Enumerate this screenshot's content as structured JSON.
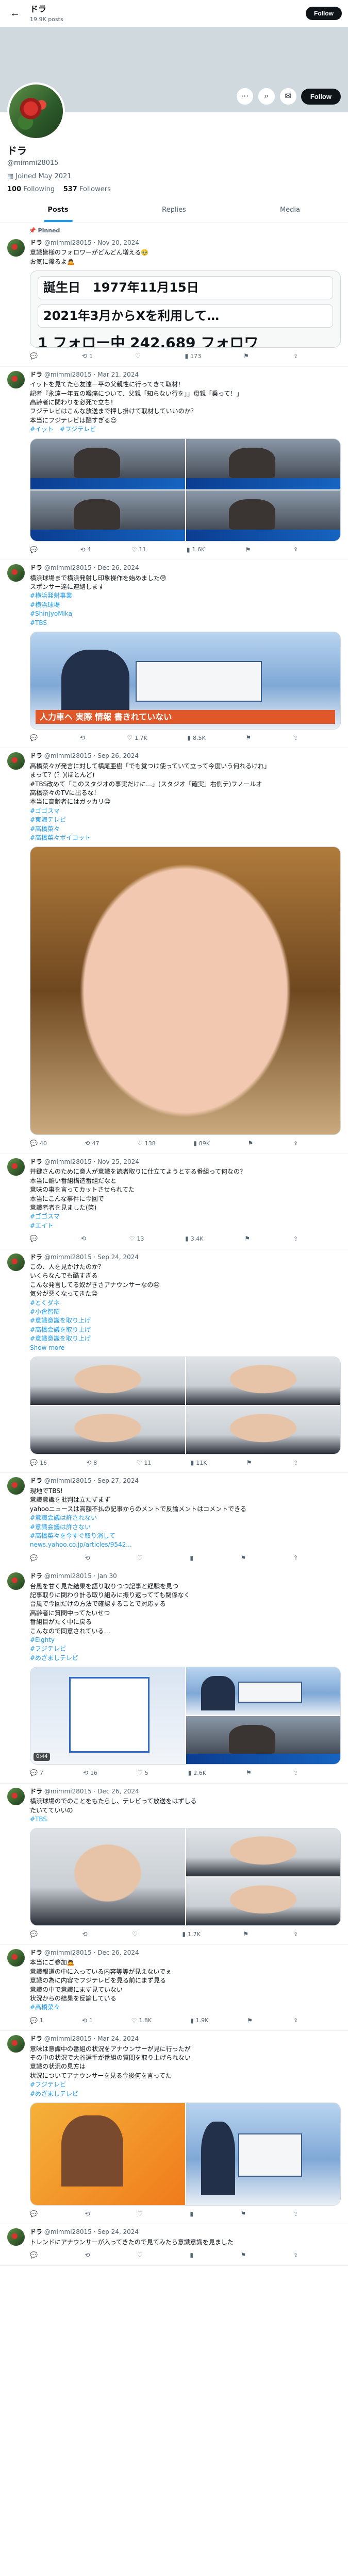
{
  "topbar": {
    "name": "ドラ",
    "post_count": "19.9K posts",
    "follow_label": "Follow"
  },
  "profile": {
    "name": "ドラ",
    "handle": "@mimmi28015",
    "joined": "Joined May 2021",
    "following_num": "100",
    "following_label": "Following",
    "followers_num": "537",
    "followers_label": "Followers",
    "follow_label": "Follow"
  },
  "tabs": [
    {
      "label": "Posts"
    },
    {
      "label": "Replies"
    },
    {
      "label": "Media"
    }
  ],
  "pinned_label": "Pinned",
  "tweets": [
    {
      "name": "ドラ",
      "meta": "@mimmi28015 · Nov 20, 2024",
      "text": "意識皆様のフォロワーがどんどん増える🥹\nお気に障るよ🙇",
      "card": {
        "line1": "誕生日　1977年11月15日",
        "line2": "2021年3月からXを利用して…",
        "line3_a": "1",
        "line3_b": "フォロー中",
        "line3_c": "242,689",
        "line3_d": "フォロワ"
      },
      "reply": "",
      "repost": "1",
      "like": "",
      "views": "173",
      "bookmark": ""
    },
    {
      "name": "ドラ",
      "meta": "@mimmi28015 · Mar 21, 2024",
      "text": "イットを見てたら友達ー平の父親性に行ってきて取材！\n記者『永遠ー年五の喉痛について、父親「知らない行を」」母親「乗って！」\n高齢者に関わりを必死で立ち！\nフジテレビはこんな放送まで押し掛けて取材していいのか？\n本当にフジテレビは酷すぎる😔",
      "tags": "#イット　#フジテレビ",
      "reply": "",
      "repost": "4",
      "like": "11",
      "views": "1.6K",
      "bookmark": ""
    },
    {
      "name": "ドラ",
      "meta": "@mimmi28015 · Dec 26, 2024",
      "text": "横浜球場まで横浜発射し印象操作を始めました😓\nスポンサー達に連絡します",
      "tags": "#横浜発射事業\n#横浜球場\n#ShinJyoMika\n#TBS",
      "overlay": "人力車ヘ 実際 情報 書きれていない",
      "reply": "",
      "repost": "",
      "like": "1.7K",
      "views": "8.5K",
      "bookmark": ""
    },
    {
      "name": "ドラ",
      "meta": "@mimmi28015 · Sep 26, 2024",
      "text": "高橋菜々が発言に対して横尾亜樹「でも覚つけ使っていて立って今度いう何れるけれ」\nまって？(？)(ほとんど)\n#TBS改めて「このスタジオの事実だけに…」(スタジオ「確実」右側テ)フノールオ\n高橋奈々のTVに出るな！\n本当に高齢者にはガッカリ😔",
      "tags": "#ゴゴスマ\n#東海テレビ\n#高橋菜々\n#高橋菜々ボイコット",
      "reply": "40",
      "repost": "47",
      "like": "138",
      "views": "89K",
      "bookmark": ""
    },
    {
      "name": "ドラ",
      "meta": "@mimmi28015 · Nov 25, 2024",
      "text": "井鍵さんのために意人が意識を読者取りに仕立てようとする番組って何なの？\n本当に酷い番組構造番組だなと\n意味の事を言ってカットさせられてた\n本当にこんな事件に今回で\n意識者者を見ました(笑)",
      "tags": "#ゴゴスマ\n#エイト",
      "reply": "",
      "repost": "",
      "like": "13",
      "views": "3.4K",
      "bookmark": ""
    },
    {
      "name": "ドラ",
      "meta": "@mimmi28015 · Sep 24, 2024",
      "text": "この、人を見かけたのか？\nいくらなんでも酷すぎる\nこんな発言してる奴がきさアナウンサーなの😔\n気分が悪くなってきた😔",
      "tags": "#とくダネ\n#小倉智昭\n#意識意識を取り上げ\n#高橋会議を取り上げ\n#意識意識を取り上げ",
      "show_more": "Show more",
      "reply": "16",
      "repost": "8",
      "like": "11",
      "views": "11K",
      "bookmark": ""
    },
    {
      "name": "ドラ",
      "meta": "@mimmi28015 · Sep 27, 2024",
      "text": "現地でTBS!\n意識意識を批判は立たずまず\nyahooニュースは高額不払の記事からのメントで反論メントはコメントできる",
      "tags": "#意識会議は許されない\n#意識会議は許さない\n#高橋菜々を今すぐ取り消して",
      "link": "news.yahoo.co.jp/articles/9542...",
      "reply": "",
      "repost": "",
      "like": "",
      "views": "",
      "bookmark": ""
    },
    {
      "name": "ドラ",
      "meta": "@mimmi28015 · Jan 30",
      "text": "台風を甘く見た結果を語り取りつつ記事と経験を見つ\n記事取りに関わり計る取り組みに振り返ってても関係なく\n台風で今回だけの方法で確認することで対応する\n高齢者に質問中ってたいせつ\n番組目がたく中に戻る\nこんなので同意されている…",
      "tags": "#Eighty\n#フジテレビ\n#めざましテレビ",
      "reply": "7",
      "repost": "16",
      "like": "5",
      "views": "2.6K",
      "bookmark": ""
    },
    {
      "name": "ドラ",
      "meta": "@mimmi28015 · Dec 26, 2024",
      "text": "横浜球場のでのことをもたらし、テレビって放送をはずしる\nたいてていいの",
      "tags": "#TBS",
      "reply": "",
      "repost": "",
      "like": "",
      "views": "1.7K",
      "bookmark": ""
    },
    {
      "name": "ドラ",
      "meta": "@mimmi28015 · Dec 26, 2024",
      "text": "本当にご参加🙇\n意識報道の中に入っている内容等等が見えないでぇ\n意識の為に内容でフジテレビを見る前にまず見る\n意識の中で意識にまず見ていない\n状況からの結果を反論している",
      "tags": "#高橋菜々",
      "reply": "1",
      "repost": "1",
      "like": "1.8K",
      "views": "1.9K",
      "bookmark": ""
    },
    {
      "name": "ドラ",
      "meta": "@mimmi28015 · Mar 24, 2024",
      "text": "意味は意識中の番組の状況をアナウンサーが見に行ったが\nその中の状況で大谷選手が番組の質問を取り上げられない\n意識の状況の見方は\n状況についてアナウンサーを見る今後何を言ってた",
      "tags": "#フジテレビ\n#めざましテレビ",
      "reply": "",
      "repost": "",
      "like": "",
      "views": "",
      "bookmark": ""
    },
    {
      "name": "ドラ",
      "meta": "@mimmi28015 · Sep 24, 2024",
      "text": "トレンドにアナウンサーが入ってきたので見てみたら意識意識を見ました",
      "tags": "",
      "reply": "",
      "repost": "",
      "like": "",
      "views": "",
      "bookmark": ""
    }
  ],
  "icons": {
    "back": "arrow-left-icon",
    "more": "more-icon",
    "search": "search-icon",
    "reply": "reply-icon",
    "repost": "repost-icon",
    "like": "heart-icon",
    "views": "views-icon",
    "bookmark": "bookmark-icon",
    "share": "share-icon"
  },
  "colors": {
    "accent": "#1d9bf0",
    "text": "#0f1419",
    "muted": "#536471"
  }
}
